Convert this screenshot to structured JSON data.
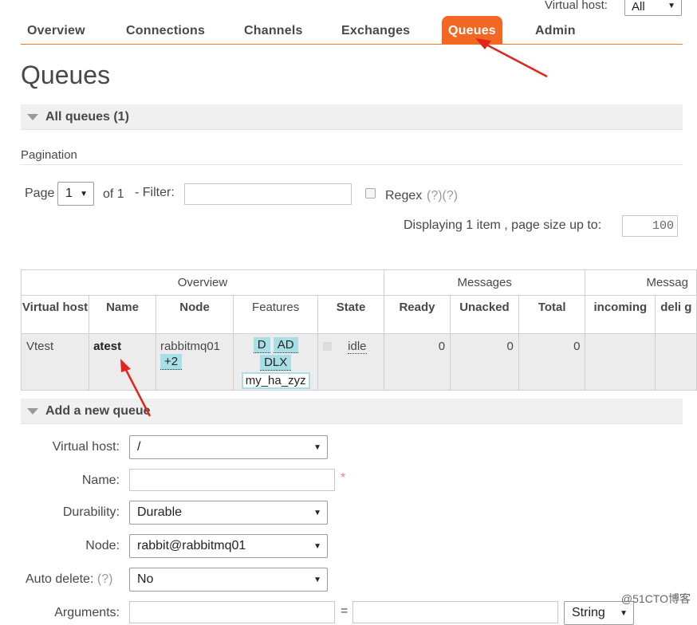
{
  "top": {
    "vhost_label": "Virtual host:",
    "vhost_value": "All"
  },
  "nav": {
    "tabs": [
      {
        "label": "Overview"
      },
      {
        "label": "Connections"
      },
      {
        "label": "Channels"
      },
      {
        "label": "Exchanges"
      },
      {
        "label": "Queues",
        "active": true
      },
      {
        "label": "Admin"
      }
    ]
  },
  "page": {
    "title": "Queues"
  },
  "all_queues": {
    "title": "All queues (1)"
  },
  "pagination": {
    "heading": "Pagination",
    "page_label": "Page",
    "page_value": "1",
    "of_label": "of 1",
    "filter_label": "- Filter:",
    "filter_value": "",
    "regex_label": "Regex",
    "regex_help": "(?)(?)",
    "display_text": "Displaying 1 item , page size up to:",
    "page_size": "100"
  },
  "table": {
    "groups": {
      "overview": "Overview",
      "messages": "Messages",
      "message_rates": "Messag"
    },
    "headers": {
      "virtual_host": "Virtual host",
      "name": "Name",
      "node": "Node",
      "features": "Features",
      "state": "State",
      "ready": "Ready",
      "unacked": "Unacked",
      "total": "Total",
      "incoming": "incoming",
      "deliver": "deli g"
    },
    "row": {
      "vhost": "Vtest",
      "name": "atest",
      "node": "rabbitmq01",
      "node_extra": "+2",
      "features": [
        "D",
        "AD",
        "DLX"
      ],
      "policy": "my_ha_zyz",
      "state": "idle",
      "ready": "0",
      "unacked": "0",
      "total": "0"
    }
  },
  "add_queue": {
    "title": "Add a new queue",
    "vhost_label": "Virtual host:",
    "vhost_value": "/",
    "name_label": "Name:",
    "name_value": "",
    "required_mark": "*",
    "durability_label": "Durability:",
    "durability_value": "Durable",
    "node_label": "Node:",
    "node_value": "rabbit@rabbitmq01",
    "autodelete_label": "Auto delete:",
    "autodelete_help": "(?)",
    "autodelete_value": "No",
    "arguments_label": "Arguments:",
    "arguments_eq": "=",
    "arguments_type": "String"
  },
  "watermark": "@51CTO博客",
  "colors": {
    "accent": "#f26722",
    "annotation": "#e0251b",
    "feature_tag": "#a8dfe6"
  }
}
